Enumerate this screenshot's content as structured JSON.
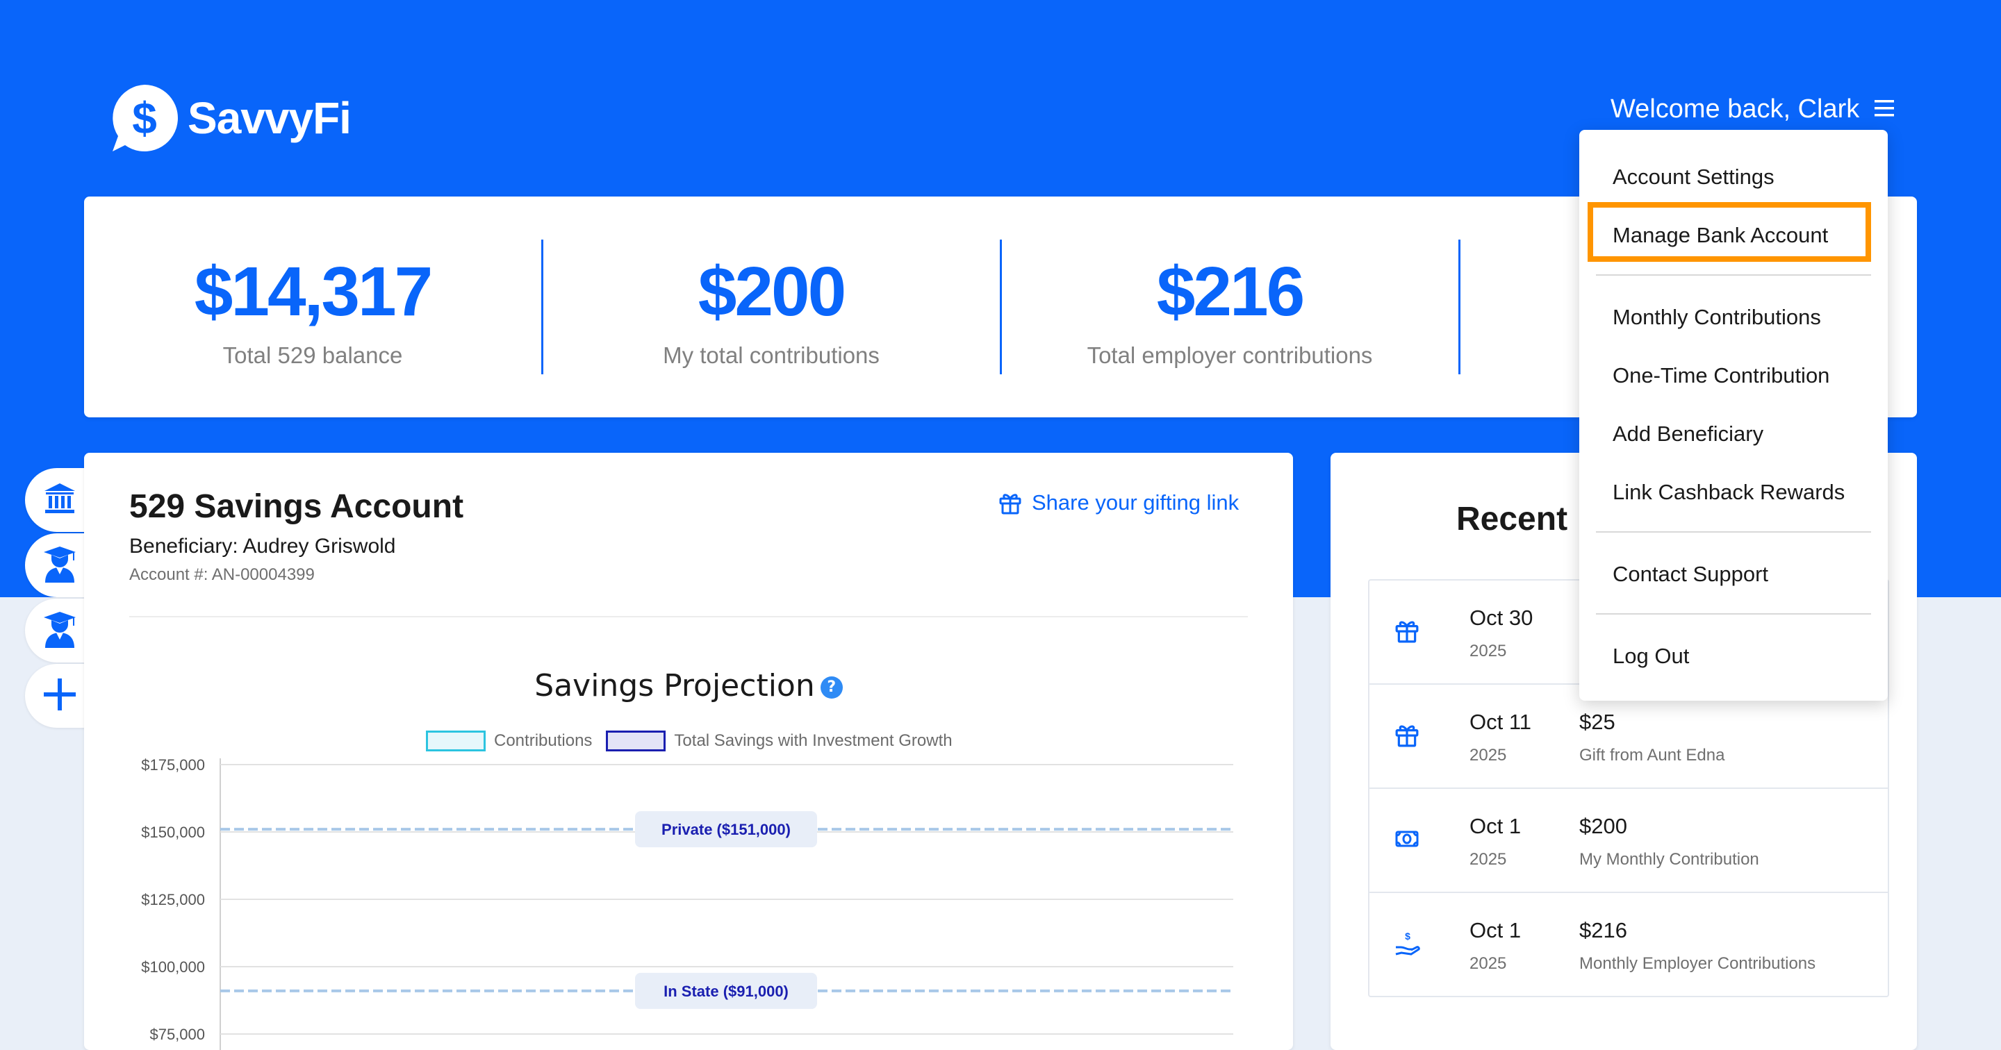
{
  "header": {
    "brand": "SavvyFi",
    "welcome": "Welcome back, Clark",
    "menu_icon": "hamburger-menu-icon",
    "brand_color": "#0965fa"
  },
  "stats": [
    {
      "value": "$14,317",
      "label": "Total 529 balance"
    },
    {
      "value": "$200",
      "label": "My total contributions"
    },
    {
      "value": "$216",
      "label": "Total employer contributions"
    }
  ],
  "sidebar": {
    "items": [
      {
        "icon": "bank-icon"
      },
      {
        "icon": "graduate-icon"
      },
      {
        "icon": "graduate-icon"
      },
      {
        "icon": "plus-icon"
      }
    ]
  },
  "account": {
    "title": "529 Savings Account",
    "beneficiary": "Beneficiary: Audrey Griswold",
    "account_number": "Account #: AN-00004399",
    "share_link": "Share your gifting link",
    "share_icon": "gift-icon"
  },
  "chart_data": {
    "type": "line",
    "title": "Savings Projection",
    "help": "?",
    "legend": [
      "Contributions",
      "Total Savings with Investment Growth"
    ],
    "y_ticks": [
      "$175,000",
      "$150,000",
      "$125,000",
      "$100,000",
      "$75,000"
    ],
    "ylim": [
      75000,
      175000
    ],
    "reference_lines": [
      {
        "label": "Private ($151,000)",
        "value": 151000
      },
      {
        "label": "In State ($91,000)",
        "value": 91000
      }
    ],
    "colors": {
      "contributions": "#2cc4e0",
      "growth": "#1a1fb0",
      "reference": "#a8c8e8"
    }
  },
  "recent": {
    "title": "Recent",
    "transactions": [
      {
        "date": "Oct 30",
        "year": "2025",
        "amount": "",
        "desc": "",
        "icon": "gift-icon"
      },
      {
        "date": "Oct 11",
        "year": "2025",
        "amount": "$25",
        "desc": "Gift from Aunt Edna",
        "icon": "gift-icon"
      },
      {
        "date": "Oct 1",
        "year": "2025",
        "amount": "$200",
        "desc": "My Monthly Contribution",
        "icon": "money-bill-icon"
      },
      {
        "date": "Oct 1",
        "year": "2025",
        "amount": "$216",
        "desc": "Monthly Employer Contributions",
        "icon": "hand-dollar-icon"
      }
    ]
  },
  "menu": {
    "items": [
      "Account Settings",
      "Manage Bank Account",
      "Monthly Contributions",
      "One-Time Contribution",
      "Add Beneficiary",
      "Link Cashback Rewards",
      "Contact Support",
      "Log Out"
    ],
    "highlight_color": "#ff9500"
  }
}
